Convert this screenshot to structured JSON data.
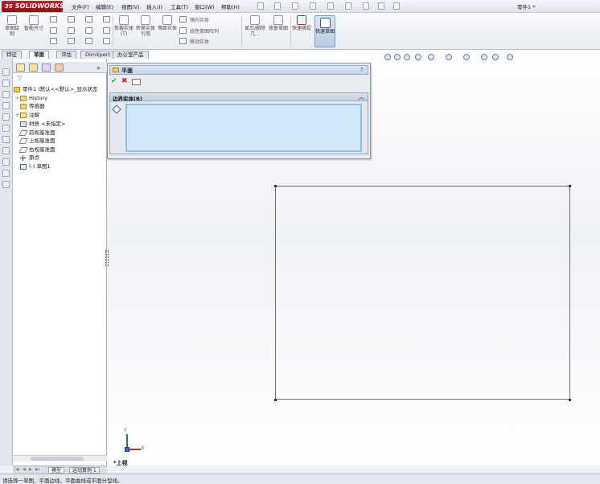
{
  "app": {
    "logo": "SOLIDWORKS",
    "document_title": "零件1 *"
  },
  "menu": [
    "文件(F)",
    "编辑(E)",
    "视图(V)",
    "插入(I)",
    "工具(T)",
    "窗口(W)",
    "帮助(H)"
  ],
  "toolbar": {
    "sketch_label": "草图绘制",
    "smart_dim_label": "智能尺寸",
    "trim_label": "剪裁实体(T)",
    "convert_label": "转换实体引用",
    "offset_label": "等距实体",
    "mirror_label": "镜向实体",
    "linear_pattern_label": "线性草图阵列",
    "move_label": "移动实体",
    "display_delete_label": "显示/删除几...",
    "repair_label": "修复草图",
    "quick_snap_label": "快速捕捉",
    "quick_sketch_label": "快速草图"
  },
  "cm_tabs": [
    "特征",
    "草图",
    "评估",
    "DimXpert",
    "办公室产品"
  ],
  "cm_active_tab": "草图",
  "feature_tree": {
    "root": "零件1 (默认<<默认>_显示状态",
    "items": [
      {
        "label": "History",
        "icon": "history-folder-icon"
      },
      {
        "label": "传感器",
        "icon": "sensor-folder-icon"
      },
      {
        "label": "注解",
        "icon": "annotation-icon"
      },
      {
        "label": "材质 <未指定>",
        "icon": "material-icon"
      },
      {
        "label": "前视基准面",
        "icon": "plane-icon"
      },
      {
        "label": "上视基准面",
        "icon": "plane-icon"
      },
      {
        "label": "右视基准面",
        "icon": "plane-icon"
      },
      {
        "label": "原点",
        "icon": "origin-icon"
      },
      {
        "label": "(-) 草图1",
        "icon": "sketch-icon"
      }
    ]
  },
  "bottom_tabs": [
    "模型",
    "运动算例 1"
  ],
  "property_manager": {
    "title": "平面",
    "help": "?",
    "group_title": "边界实体(B)"
  },
  "view": {
    "name": "*上视",
    "triad_x": "X",
    "triad_y": "Y"
  },
  "status_bar": {
    "message": "请选择一草图、平面边线、平面曲线或平面分型线。"
  },
  "colors": {
    "brand": "#c8202a",
    "selection_box": "#d2e6f8",
    "ok_green": "#2e9b2e",
    "cancel_red": "#c22626"
  }
}
